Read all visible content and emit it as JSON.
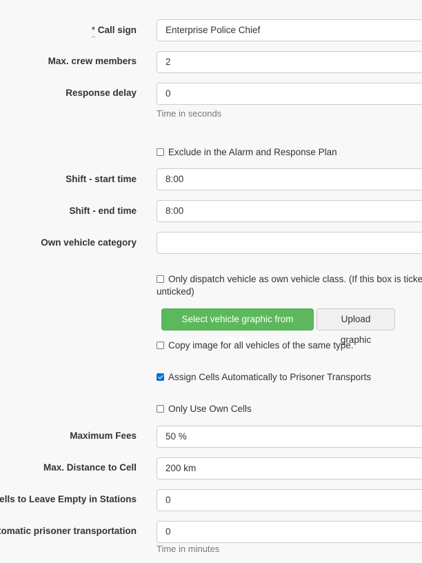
{
  "form": {
    "call_sign": {
      "required_mark": "*",
      "label": "Call sign",
      "value": "Enterprise Police Chief"
    },
    "max_crew": {
      "label": "Max. crew members",
      "value": "2"
    },
    "response_delay": {
      "label": "Response delay",
      "value": "0",
      "help": "Time in seconds"
    },
    "exclude_alarm": {
      "label": "Exclude in the Alarm and Response Plan",
      "checked": false
    },
    "shift_start": {
      "label": "Shift - start time",
      "value": "8:00"
    },
    "shift_end": {
      "label": "Shift - end time",
      "value": "8:00"
    },
    "own_vehicle_category": {
      "label": "Own vehicle category",
      "value": ""
    },
    "only_dispatch": {
      "label_line1": "Only dispatch vehicle as own vehicle class. (If this box is ticked",
      "label_line2": "unticked)",
      "checked": false
    },
    "select_graphic_button": "Select vehicle graphic from library",
    "upload_graphic_button": "Upload graphic",
    "copy_image": {
      "label": "Copy image for all vehicles of the same type.",
      "checked": false
    },
    "assign_cells": {
      "label": "Assign Cells Automatically to Prisoner Transports",
      "checked": true
    },
    "only_own_cells": {
      "label": "Only Use Own Cells",
      "checked": false
    },
    "maximum_fees": {
      "label": "Maximum Fees",
      "value": "50 %"
    },
    "max_distance": {
      "label": "Max. Distance to Cell",
      "value": "200 km"
    },
    "cells_empty": {
      "label": "Cells to Leave Empty in Stations",
      "value": "0"
    },
    "auto_prisoner": {
      "label": "utomatic prisoner transportation",
      "value": "0",
      "help": "Time in minutes"
    }
  },
  "colors": {
    "primary_green": "#5cb85c",
    "checkbox_blue": "#0a6fd6",
    "help_text": "#777777"
  }
}
